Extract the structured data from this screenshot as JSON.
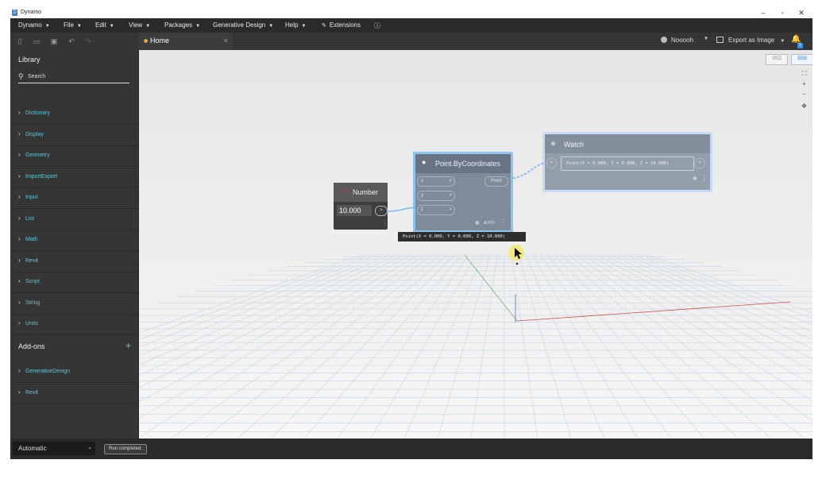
{
  "window": {
    "title": "Dynamo",
    "controls": {
      "minimize": "–",
      "restore": "▫",
      "close": "✕"
    }
  },
  "menu": {
    "items": [
      {
        "label": "Dynamo",
        "caret": "▼"
      },
      {
        "label": "File",
        "caret": "▼"
      },
      {
        "label": "Edit",
        "caret": "▼"
      },
      {
        "label": "View",
        "caret": "▼"
      },
      {
        "label": "Packages",
        "caret": "▼"
      },
      {
        "label": "Generative Design",
        "caret": "▼"
      },
      {
        "label": "Help",
        "caret": "▼"
      },
      {
        "label": "Extensions",
        "caret": ""
      }
    ],
    "info_icon": "ⓘ"
  },
  "toolbar": {
    "icons": [
      "new-file-icon",
      "open-folder-icon",
      "save-icon",
      "undo-icon",
      "redo-icon"
    ],
    "glyphs": {
      "new": "▯",
      "open": "▭",
      "save": "▣",
      "undo": "↶",
      "redo": "↷"
    }
  },
  "tab": {
    "label": "Home",
    "close": "×"
  },
  "user": {
    "name": "Nooooh",
    "caret": "▼"
  },
  "export": {
    "label": "Export as Image",
    "caret": "▼"
  },
  "notifications": {
    "count": "1"
  },
  "library": {
    "title": "Library",
    "search_placeholder": "Search",
    "categories": [
      "Dictionary",
      "Display",
      "Geometry",
      "ImportExport",
      "Input",
      "List",
      "Math",
      "Revit",
      "Script",
      "String",
      "Units"
    ],
    "addons_title": "Add-ons",
    "addons": [
      "GenerativeDesign",
      "Revit"
    ]
  },
  "nodes": {
    "number": {
      "title": "Number",
      "value": "10.000",
      "out": ">"
    },
    "point": {
      "title": "Point.ByCoordinates",
      "inputs": [
        "x",
        "y",
        "z"
      ],
      "output": "Point",
      "lacing": "AUTO",
      "preview": "Point(X = 0.000, Y = 0.000, Z = 10.000)"
    },
    "watch": {
      "title": "Watch",
      "value": "Point(X = 0.000, Y = 0.000, Z = 10.000)"
    }
  },
  "status": {
    "run_mode": "Automatic",
    "run_message": "Run completed."
  },
  "colors": {
    "accent": "#5b9bd5",
    "category_text": "#5ec8d6",
    "background": "#353535"
  }
}
